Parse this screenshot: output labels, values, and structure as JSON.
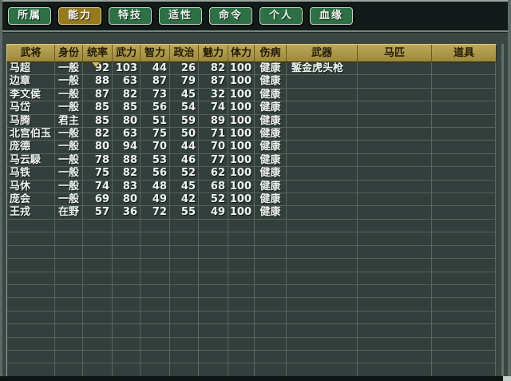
{
  "tabs": [
    {
      "label": "所属",
      "selected": false
    },
    {
      "label": "能力",
      "selected": true
    },
    {
      "label": "特技",
      "selected": false
    },
    {
      "label": "适性",
      "selected": false
    },
    {
      "label": "命令",
      "selected": false
    },
    {
      "label": "个人",
      "selected": false
    },
    {
      "label": "血缘",
      "selected": false
    }
  ],
  "table": {
    "columns": [
      "武将",
      "身份",
      "统率",
      "武力",
      "智力",
      "政治",
      "魅力",
      "体力",
      "伤病",
      "武器",
      "马匹",
      "道具"
    ],
    "sort": {
      "column": "统率",
      "direction": "desc"
    },
    "rows": [
      {
        "name": "马超",
        "identity": "一般",
        "stats": [
          92,
          103,
          44,
          26,
          82,
          100
        ],
        "condition": "健康",
        "weapon": "錾金虎头枪",
        "horse": "",
        "item": ""
      },
      {
        "name": "边章",
        "identity": "一般",
        "stats": [
          88,
          63,
          87,
          79,
          87,
          100
        ],
        "condition": "健康",
        "weapon": "",
        "horse": "",
        "item": ""
      },
      {
        "name": "李文侯",
        "identity": "一般",
        "stats": [
          87,
          82,
          73,
          45,
          32,
          100
        ],
        "condition": "健康",
        "weapon": "",
        "horse": "",
        "item": ""
      },
      {
        "name": "马岱",
        "identity": "一般",
        "stats": [
          85,
          85,
          56,
          54,
          74,
          100
        ],
        "condition": "健康",
        "weapon": "",
        "horse": "",
        "item": ""
      },
      {
        "name": "马腾",
        "identity": "君主",
        "stats": [
          85,
          80,
          51,
          59,
          89,
          100
        ],
        "condition": "健康",
        "weapon": "",
        "horse": "",
        "item": ""
      },
      {
        "name": "北宫伯玉",
        "identity": "一般",
        "stats": [
          82,
          63,
          75,
          50,
          71,
          100
        ],
        "condition": "健康",
        "weapon": "",
        "horse": "",
        "item": ""
      },
      {
        "name": "庞德",
        "identity": "一般",
        "stats": [
          80,
          94,
          70,
          44,
          70,
          100
        ],
        "condition": "健康",
        "weapon": "",
        "horse": "",
        "item": ""
      },
      {
        "name": "马云騄",
        "identity": "一般",
        "stats": [
          78,
          88,
          53,
          46,
          77,
          100
        ],
        "condition": "健康",
        "weapon": "",
        "horse": "",
        "item": ""
      },
      {
        "name": "马铁",
        "identity": "一般",
        "stats": [
          75,
          82,
          56,
          52,
          62,
          100
        ],
        "condition": "健康",
        "weapon": "",
        "horse": "",
        "item": ""
      },
      {
        "name": "马休",
        "identity": "一般",
        "stats": [
          74,
          83,
          48,
          45,
          68,
          100
        ],
        "condition": "健康",
        "weapon": "",
        "horse": "",
        "item": ""
      },
      {
        "name": "庞会",
        "identity": "一般",
        "stats": [
          69,
          80,
          49,
          42,
          52,
          100
        ],
        "condition": "健康",
        "weapon": "",
        "horse": "",
        "item": ""
      },
      {
        "name": "王戎",
        "identity": "在野",
        "stats": [
          57,
          36,
          72,
          55,
          49,
          100
        ],
        "condition": "健康",
        "weapon": "",
        "horse": "",
        "item": ""
      }
    ],
    "empty_filler_rows": 12
  },
  "colors": {
    "header_gold": "#ad9847",
    "tab_green": "#2e7045",
    "tab_selected_gold": "#967a20",
    "top_bar": "#121a19",
    "panel_bg": "#3a4642",
    "grid_bg": "#333f3c",
    "grid_line": "#a5b9af",
    "row_text": "#f0f4ef",
    "header_text": "#241c05",
    "sort_arrow": "#d5ba4e"
  }
}
